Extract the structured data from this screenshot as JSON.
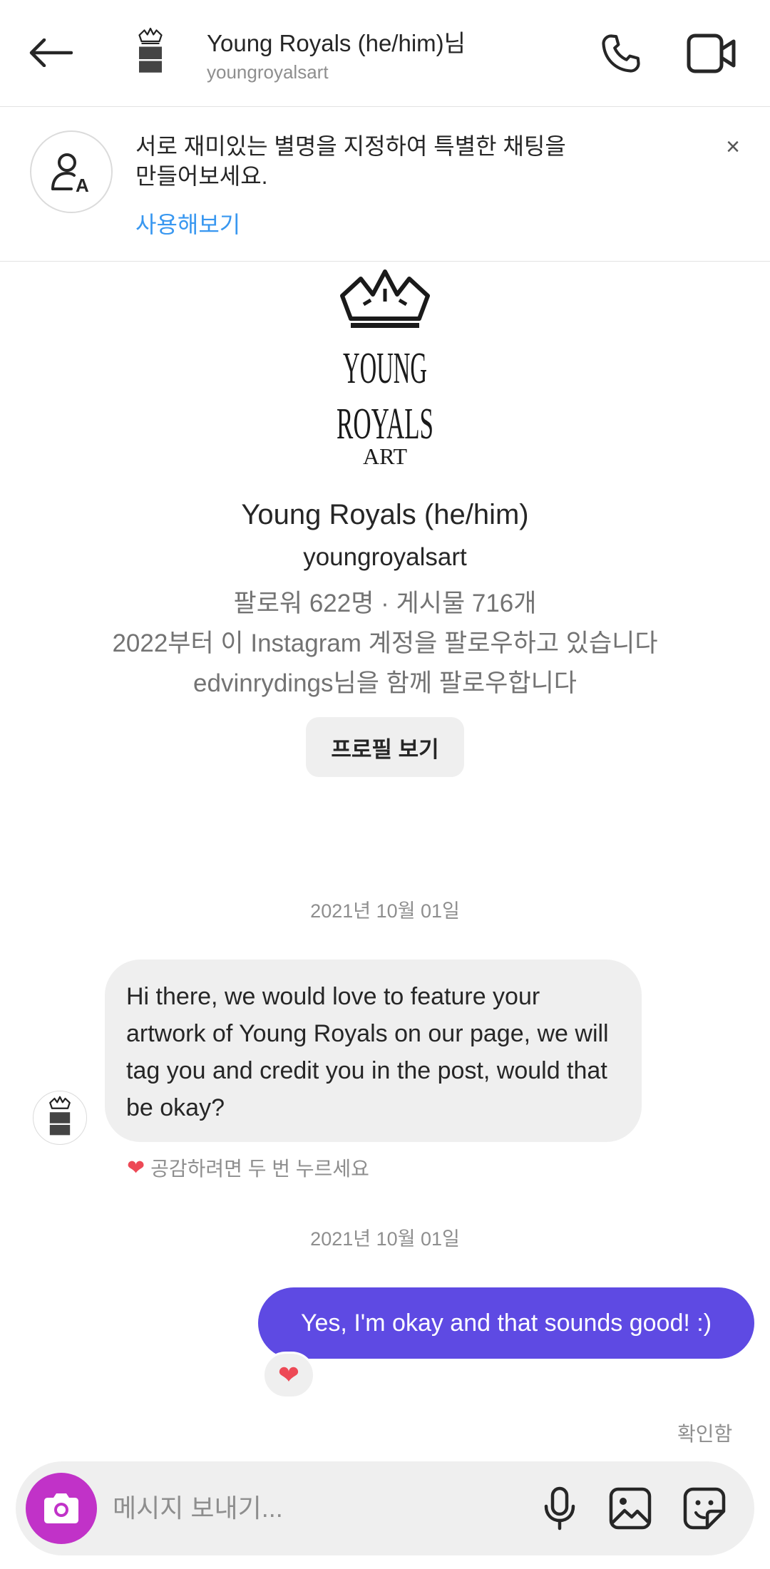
{
  "header": {
    "name": "Young Royals (he/him)님",
    "username": "youngroyalsart"
  },
  "banner": {
    "text": "서로 재미있는 별명을 지정하여 특별한 채팅을 만들어보세요.",
    "link": "사용해보기",
    "close": "×"
  },
  "profile": {
    "logo_text": [
      "YOUNG",
      "ROYALS",
      "ART"
    ],
    "name": "Young Royals (he/him)",
    "username": "youngroyalsart",
    "stats": "팔로워 622명 · 게시물 716개",
    "following_since": "2022부터 이 Instagram 계정을 팔로우하고 있습니다",
    "mutual": "edvinrydings님을 함께 팔로우합니다",
    "view_profile_label": "프로필 보기"
  },
  "messages": {
    "date_1": "2021년 10월 01일",
    "incoming_text": "Hi there, we would love to feature your artwork of Young Royals on our page, we will tag you and credit you in the post, would that be okay?",
    "react_hint": "공감하려면 두 번 누르세요",
    "date_2": "2021년 10월 01일",
    "outgoing_text": "Yes, I'm okay and that sounds good! :)",
    "reaction": "❤",
    "seen": "확인함"
  },
  "composer": {
    "placeholder": "메시지 보내기..."
  },
  "colors": {
    "accent_purple": "#5e4ae3",
    "camera_magenta": "#c132c8",
    "link_blue": "#3897f0",
    "heart_red": "#ed4956"
  },
  "icons": [
    "back-arrow-icon",
    "phone-icon",
    "video-camera-icon",
    "nickname-icon",
    "close-icon",
    "heart-icon",
    "camera-icon",
    "microphone-icon",
    "gallery-icon",
    "sticker-icon"
  ]
}
